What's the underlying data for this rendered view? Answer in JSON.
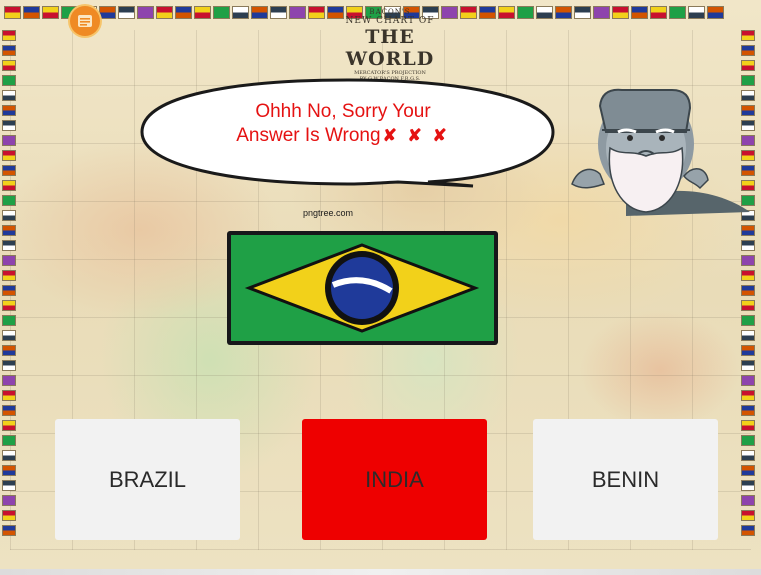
{
  "map": {
    "title_small": "BACON'S",
    "title_mid": "NEW CHART OF",
    "title_big": "THE WORLD",
    "title_sub1": "MERCATOR'S PROJECTION",
    "title_sub2": "BY G.W.BACON F.R.G.S.",
    "watermark": "pngtree.com"
  },
  "home_button": {
    "icon": "home-icon",
    "color": "#ef8a24"
  },
  "feedback": {
    "line1": "Ohhh No, Sorry Your",
    "line2": "Answer Is Wrong",
    "marks": "✘ ✘ ✘",
    "color": "#e51212"
  },
  "question": {
    "flag": "brazil-flag"
  },
  "answers": [
    {
      "label": "BRAZIL",
      "state": "default",
      "color": "#f2f2f2"
    },
    {
      "label": "INDIA",
      "state": "selected-wrong",
      "color": "#ee0000"
    },
    {
      "label": "BENIN",
      "state": "default",
      "color": "#f2f2f2"
    }
  ]
}
